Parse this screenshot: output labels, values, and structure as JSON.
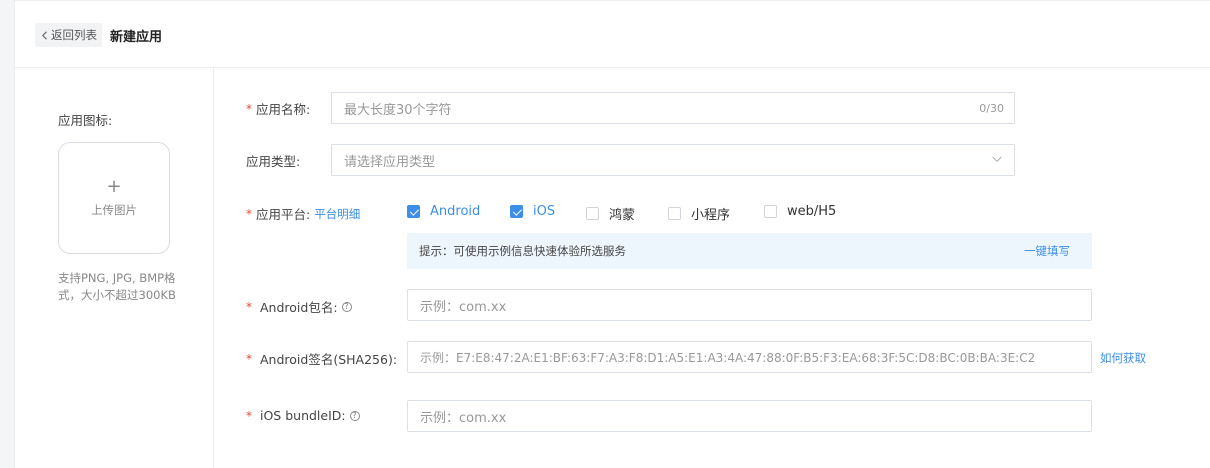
{
  "header": {
    "back_label": "返回列表",
    "title": "新建应用"
  },
  "icon_upload": {
    "label": "应用图标:",
    "plus": "+",
    "button_text": "上传图片",
    "hint": "支持PNG, JPG, BMP格式，大小不超过300KB"
  },
  "form": {
    "app_name": {
      "required_mark": "*",
      "label": "应用名称:",
      "placeholder": "最大长度30个字符",
      "counter": "0/30"
    },
    "app_type": {
      "label": "应用类型:",
      "placeholder": "请选择应用类型"
    },
    "platform": {
      "required_mark": "*",
      "label": "应用平台:",
      "detail_link": "平台明细",
      "options": [
        {
          "label": "Android",
          "checked": true
        },
        {
          "label": "iOS",
          "checked": true
        },
        {
          "label": "鸿蒙",
          "checked": false
        },
        {
          "label": "小程序",
          "checked": false
        },
        {
          "label": "web/H5",
          "checked": false
        }
      ],
      "tip_text": "提示：可使用示例信息快速体验所选服务",
      "tip_action": "一键填写"
    },
    "android_package": {
      "required_mark": "*",
      "label": "Android包名:",
      "help": "?",
      "placeholder": "示例：com.xx"
    },
    "android_signature": {
      "required_mark": "*",
      "label": "Android签名(SHA256):",
      "placeholder": "示例：E7:E8:47:2A:E1:BF:63:F7:A3:F8:D1:A5:E1:A3:4A:47:88:0F:B5:F3:EA:68:3F:5C:D8:BC:0B:BA:3E:C2",
      "how_link": "如何获取"
    },
    "ios_bundle": {
      "required_mark": "*",
      "label": "iOS bundleID:",
      "help": "?",
      "placeholder": "示例：com.xx"
    }
  },
  "colors": {
    "accent": "#3c8ee8",
    "required": "#e5483c",
    "tip_bg": "#eef6fd"
  }
}
